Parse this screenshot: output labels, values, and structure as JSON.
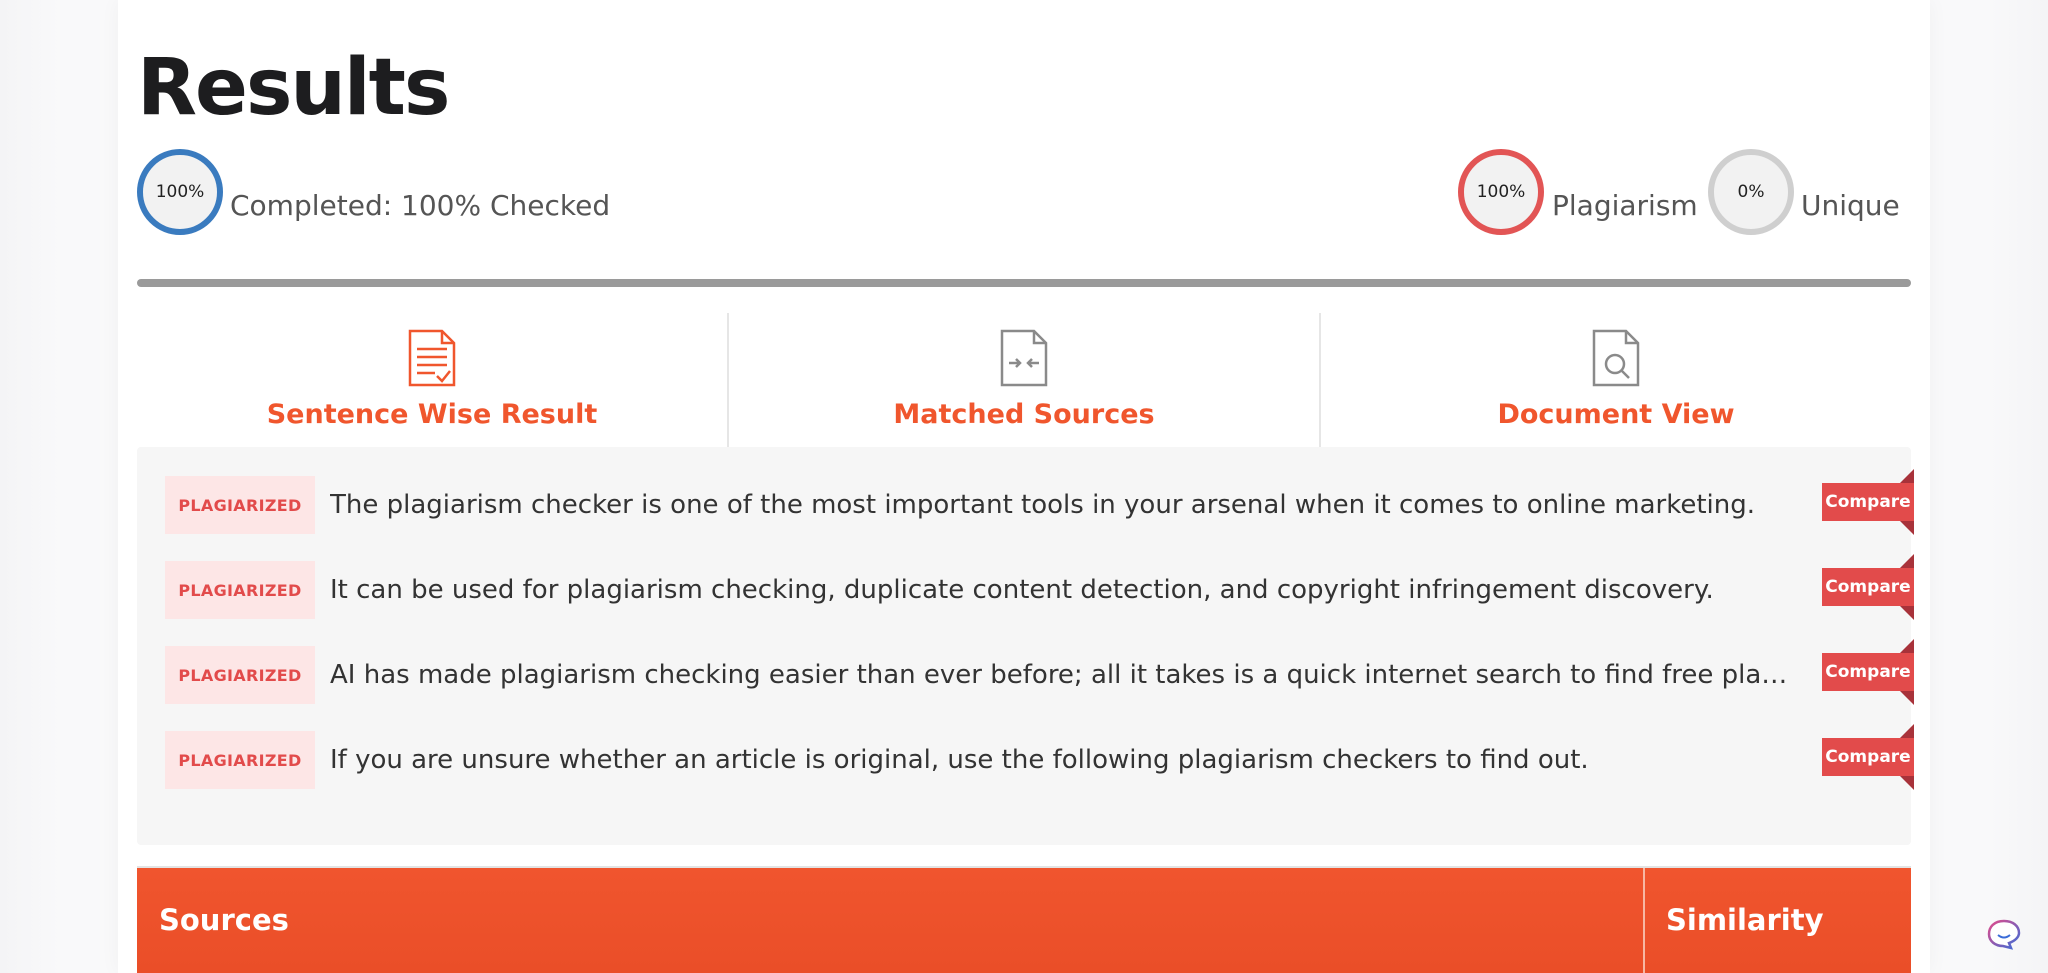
{
  "page": {
    "title": "Results"
  },
  "progress": {
    "completed_ring": "100%",
    "completed_label": "Completed: 100% Checked",
    "completed_fraction": 1.0,
    "plagiarism_ring": "100%",
    "plagiarism_label": "Plagiarism",
    "unique_ring": "0%",
    "unique_label": "Unique"
  },
  "tabs": [
    {
      "label": "Sentence Wise Result",
      "icon": "document-check-icon"
    },
    {
      "label": "Matched Sources",
      "icon": "document-compare-icon"
    },
    {
      "label": "Document View",
      "icon": "document-search-icon"
    }
  ],
  "results": [
    {
      "badge": "PLAGIARIZED",
      "text": "The plagiarism checker is one of the most important tools in your arsenal when it comes to online marketing.",
      "action": "Compare"
    },
    {
      "badge": "PLAGIARIZED",
      "text": "It can be used for plagiarism checking, duplicate content detection, and copyright infringement discovery.",
      "action": "Compare"
    },
    {
      "badge": "PLAGIARIZED",
      "text": "AI has made plagiarism checking easier than ever before; all it takes is a quick internet search to find free pla…",
      "action": "Compare"
    },
    {
      "badge": "PLAGIARIZED",
      "text": "If you are unsure whether an article is original, use the following plagiarism checkers to find out.",
      "action": "Compare"
    }
  ],
  "table": {
    "col_sources": "Sources",
    "col_similarity": "Similarity"
  },
  "colors": {
    "accent": "#f0562d",
    "plagiarized": "#e24b4b",
    "completed_ring": "#3a7bbf",
    "unique_ring": "#cfcfcf"
  }
}
